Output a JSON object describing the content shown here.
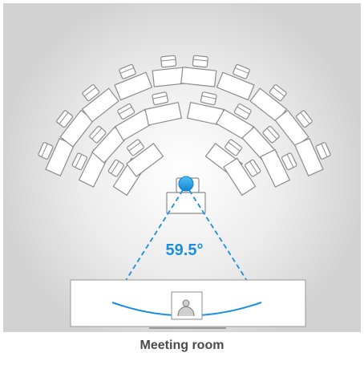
{
  "diagram": {
    "angle_label": "59.5°",
    "caption": "Meeting room",
    "colors": {
      "accent": "#1a8fdc",
      "camera": "#1ea0e8",
      "room_bg": "#dedede",
      "furniture_stroke": "#8c8c8c"
    },
    "icons": [
      "camera-icon",
      "person-icon",
      "desk-icon",
      "chair-icon"
    ]
  }
}
